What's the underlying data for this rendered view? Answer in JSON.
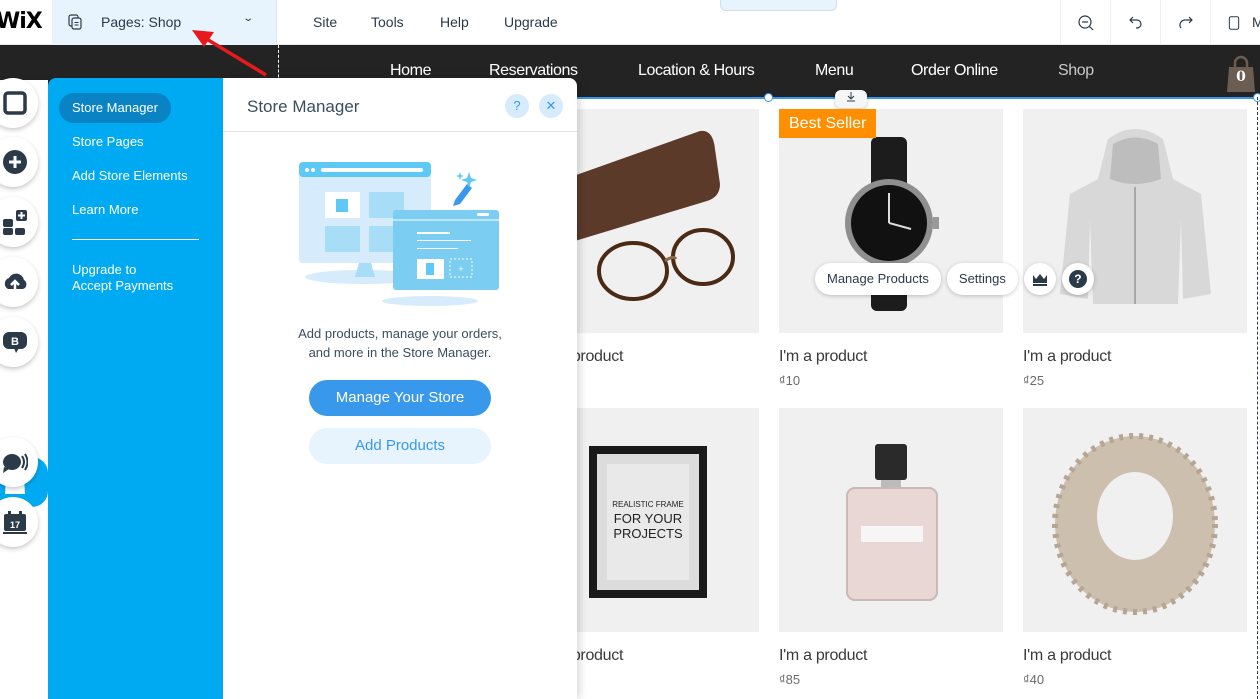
{
  "topbar": {
    "logo": "WiX",
    "pages_label": "Pages: Shop",
    "menu": [
      "Site",
      "Tools",
      "Help",
      "Upgrade"
    ],
    "collapse_glyph": "^",
    "tools": [
      "zoom-out-icon",
      "undo-icon",
      "redo-icon",
      "mobile-icon"
    ],
    "mobile_label": "M"
  },
  "site_nav": {
    "links": [
      "Home",
      "Reservations",
      "Location & Hours",
      "Menu",
      "Order Online",
      "Shop"
    ],
    "active": "Shop",
    "cart_count": "0"
  },
  "left_rail": {
    "buttons": [
      "background-icon",
      "add-icon",
      "add-apps-icon",
      "upload-icon",
      "blog-icon",
      "store-icon",
      "chat-icon",
      "bookings-icon"
    ],
    "active": "store-icon"
  },
  "store_panel": {
    "side_items": [
      "Store Manager",
      "Store Pages",
      "Add Store Elements",
      "Learn More"
    ],
    "selected": "Store Manager",
    "upgrade_line1": "Upgrade to",
    "upgrade_line2": "Accept Payments",
    "title": "Store Manager",
    "help_glyph": "?",
    "close_glyph": "✕",
    "desc_line1": "Add products, manage your orders,",
    "desc_line2": "and more in the Store Manager.",
    "primary_button": "Manage Your Store",
    "secondary_button": "Add Products",
    "colors": {
      "accent": "#00aaf2",
      "button": "#3899ec",
      "selected": "#0983c4"
    }
  },
  "gallery": {
    "badge": "Best Seller",
    "products": [
      {
        "name": "I'm a product",
        "price": "",
        "image": "glasses"
      },
      {
        "name": "I'm a product",
        "price": "₫10",
        "image": "watch"
      },
      {
        "name": "I'm a product",
        "price": "₫25",
        "image": "hoodie"
      },
      {
        "name": "I'm a product",
        "price": "",
        "image": "frame"
      },
      {
        "name": "I'm a product",
        "price": "₫85",
        "image": "perfume"
      },
      {
        "name": "I'm a product",
        "price": "₫40",
        "image": "scarf"
      }
    ],
    "frame_text": [
      "REALISTIC FRAME",
      "FOR YOUR",
      "PROJECTS"
    ],
    "gfpp": {
      "manage": "Manage Products",
      "settings": "Settings",
      "crown": "crown-icon",
      "help": "?"
    },
    "badge_color": "#ff8f00"
  }
}
